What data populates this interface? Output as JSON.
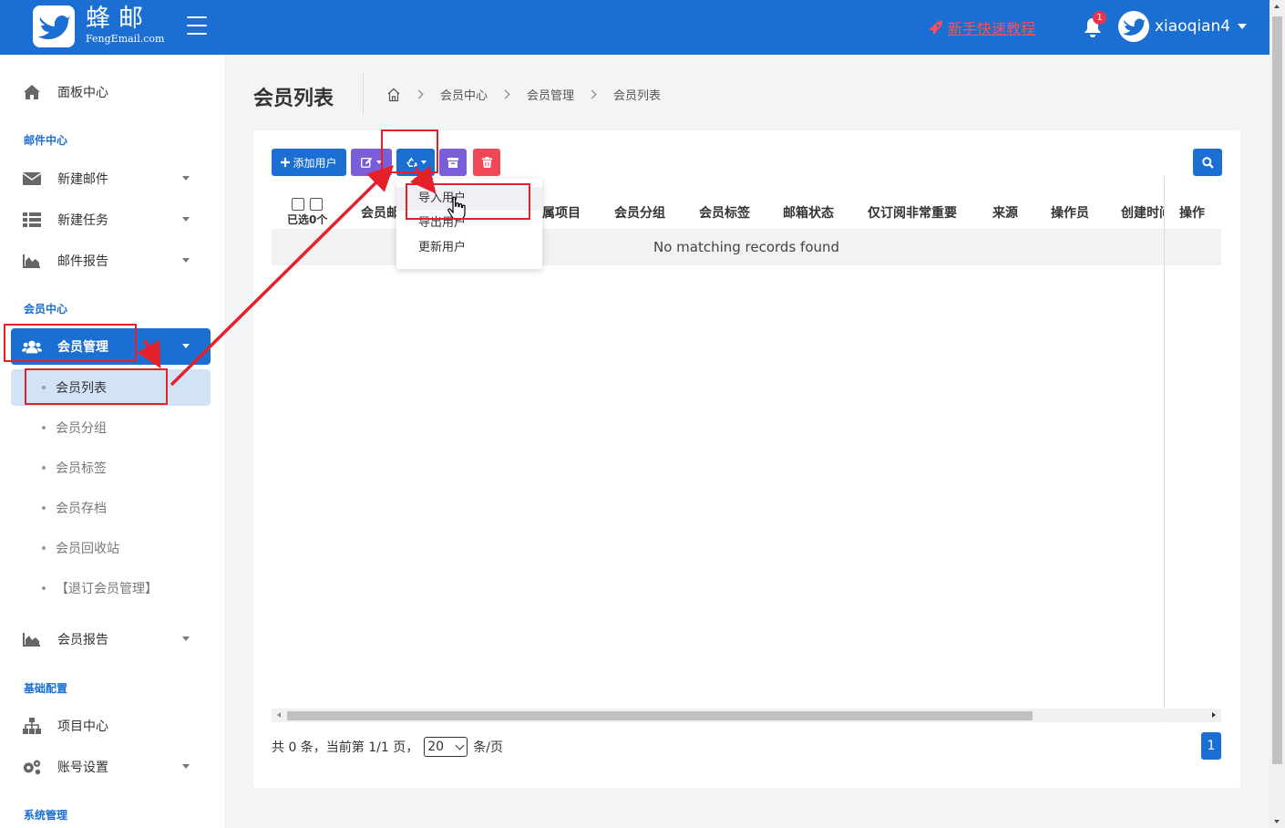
{
  "brand": {
    "name_cn": "蜂邮",
    "name_en": "FengEmail.com"
  },
  "topbar": {
    "tutorial_label": "新手快速教程",
    "notification_count": "1",
    "username": "xiaoqian4"
  },
  "sidebar": {
    "dashboard": "面板中心",
    "sections": {
      "mail": "邮件中心",
      "member": "会员中心",
      "config": "基础配置",
      "system": "系统管理"
    },
    "mail_items": [
      "新建邮件",
      "新建任务",
      "邮件报告"
    ],
    "member_manage": "会员管理",
    "member_sub": [
      "会员列表",
      "会员分组",
      "会员标签",
      "会员存档",
      "会员回收站",
      "【退订会员管理】"
    ],
    "member_report": "会员报告",
    "config_items": [
      "项目中心",
      "账号设置"
    ]
  },
  "header": {
    "title": "会员列表",
    "breadcrumb": [
      "会员中心",
      "会员管理",
      "会员列表"
    ]
  },
  "toolbar": {
    "add_label": "添加用户"
  },
  "dropdown": {
    "items": [
      "导入用户",
      "导出用户",
      "更新用户"
    ]
  },
  "table": {
    "selected_label": "已选0个",
    "columns": [
      "会员邮",
      "属项目",
      "会员分组",
      "会员标签",
      "邮箱状态",
      "仅订阅非常重要",
      "来源",
      "操作员",
      "创建时间",
      "操作"
    ],
    "empty_text": "No matching records found"
  },
  "pager": {
    "summary": "共 0 条，当前第 1/1 页，",
    "page_size": "20",
    "per_page": "条/页",
    "current": "1"
  },
  "colors": {
    "primary": "#1b6fd2",
    "purple": "#7a5ed8",
    "danger": "#ef4757",
    "annotation": "#e6202a"
  }
}
